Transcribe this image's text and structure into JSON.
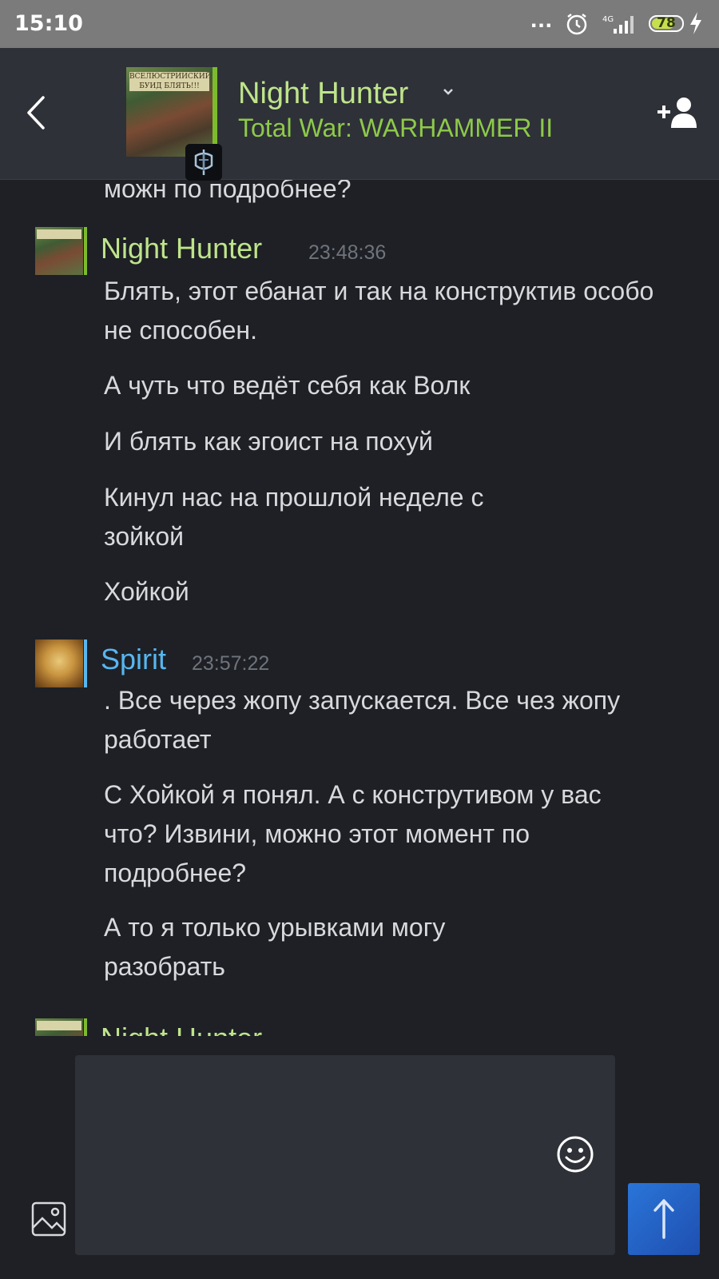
{
  "status_bar": {
    "time": "15:10",
    "dots": "...",
    "network": "4G",
    "battery": "78",
    "battery_level": 0.78
  },
  "header": {
    "contact_name": "Night Hunter",
    "game": "Total War: WARHAMMER II",
    "avatar_caption": "ВСЕЛЮСТРИИСКИЙ БУИД БЛЯТЬ!!!",
    "online_color": "#7dbb2e"
  },
  "chat": {
    "partial_top": "можн по подробнее?",
    "groups": [
      {
        "sender": "Night Hunter",
        "time": "23:48:36",
        "name_color": "#bfe48b",
        "messages": [
          "Блять, этот ебанат и так на конструктив особо не способен.",
          "А чуть что ведёт себя как Волк",
          "И блять как эгоист на похуй",
          "Кинул нас на прошлой неделе с зойкой",
          "Хойкой"
        ]
      },
      {
        "sender": "Spirit",
        "time": "23:57:22",
        "name_color": "#57b6f0",
        "messages": [
          ". Все через жопу запускается. Все чез жопу работает",
          "С Хойкой я понял. А с конструтивом у вас что? Извини, можно этот момент по подробнее?",
          "А то я только урывками могу разобрать"
        ]
      }
    ],
    "partial_bottom_sender": "Night Hunter"
  },
  "composer": {
    "placeholder": "",
    "icons": [
      "emoji-icon",
      "image-icon",
      "send-arrow-icon"
    ],
    "send_color": "#2a6fd6"
  }
}
